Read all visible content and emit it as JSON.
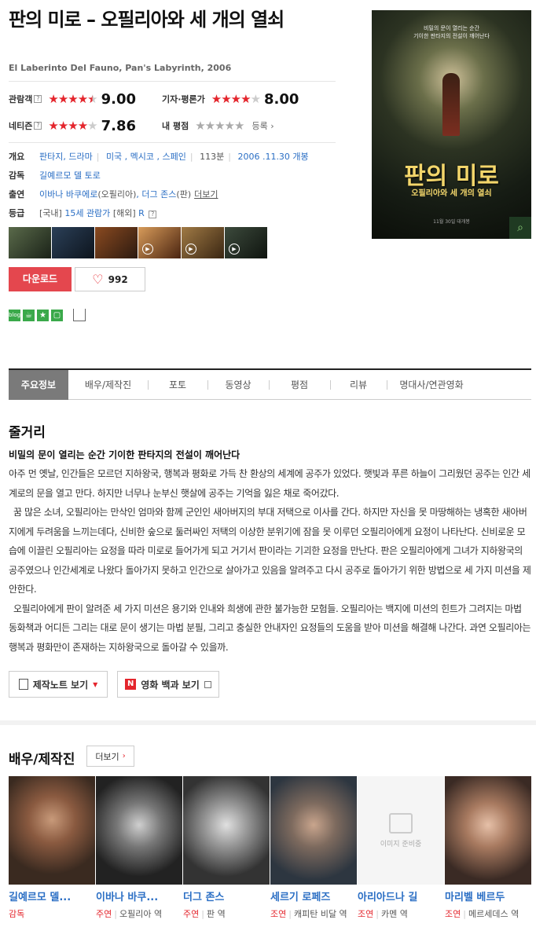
{
  "movie": {
    "title": "판의 미로 – 오필리아와 세 개의 열쇠",
    "original_title": "El Laberinto Del Fauno, Pan's Labyrinth, 2006"
  },
  "ratings": {
    "audience": {
      "label": "관람객",
      "stars": 4.5,
      "score": "9.00"
    },
    "critic": {
      "label": "기자·평론가",
      "stars": 4,
      "score": "8.00"
    },
    "netizen": {
      "label": "네티즌",
      "stars": 4,
      "score": "7.86"
    },
    "mine": {
      "label": "내 평점",
      "register": "등록"
    },
    "help_mark": "?",
    "star_glyphs": "★★★★★"
  },
  "info": {
    "genre_key": "개요",
    "genre": "판타지, 드라마",
    "country": "미국 , 멕시코 , 스페인",
    "runtime": "113분",
    "release": "2006 .11.30 개봉",
    "director_key": "감독",
    "director": "길예르모 델 토로",
    "cast_key": "출연",
    "cast1": "이바나 바쿠에로",
    "cast1_role": "(오필리아)",
    "cast2": "더그 존스",
    "cast2_role": "(판)",
    "cast_more": "더보기",
    "grade_key": "등급",
    "grade_domestic_tag": "[국내]",
    "grade_domestic": "15세 관람가",
    "grade_foreign_tag": "[해외]",
    "grade_foreign": "R"
  },
  "buttons": {
    "download": "다운로드",
    "likes": "992"
  },
  "share": {
    "blog": "blog"
  },
  "poster": {
    "tagline": "비밀의 문이 열리는 순간\n기이한 판타지의 전설이 깨어난다",
    "title": "판의 미로",
    "subtitle": "오필리아와 세 개의 열쇠",
    "date": "11월 30일 대개봉"
  },
  "tabs": [
    "주요정보",
    "배우/제작진",
    "포토",
    "동영상",
    "평점",
    "리뷰",
    "명대사/연관영화"
  ],
  "synopsis": {
    "heading": "줄거리",
    "lead": "비밀의 문이 열리는 순간 기이한 판타지의 전설이 깨어난다",
    "p1": "아주 먼 옛날, 인간들은 모르던 지하왕국, 행복과 평화로 가득 찬 환상의 세계에 공주가 있었다. 햇빛과 푸른 하늘이 그리웠던 공주는 인간 세계로의 문을 열고 만다. 하지만 너무나 눈부신 햇살에 공주는 기억을 잃은 채로 죽어갔다.",
    "p2": "꿈 많은 소녀, 오필리아는 만삭인 엄마와 함께 군인인 새아버지의 부대 저택으로 이사를 간다. 하지만 자신을 못 마땅해하는 냉혹한 새아버지에게 두려움을 느끼는데다, 신비한 숲으로 둘러싸인 저택의 이상한 분위기에 잠을 못 이루던 오필리아에게 요정이 나타난다. 신비로운 모습에 이끌린 오필리아는 요정을 따라 미로로 들어가게 되고 거기서 판이라는 기괴한 요정을 만난다. 판은 오필리아에게 그녀가 지하왕국의 공주였으나 인간세계로 나왔다 돌아가지 못하고 인간으로 살아가고 있음을 알려주고 다시 공주로 돌아가기 위한 방법으로 세 가지 미션을 제안한다.",
    "p3": "오필리아에게 판이 알려준 세 가지 미션은 용기와 인내와 희생에 관한 불가능한 모험들. 오필리아는 백지에 미션의 힌트가 그려지는 마법 동화책과 어디든 그리는 대로 문이 생기는 마법 분필, 그리고 충실한 안내자인 요정들의 도움을 받아 미션을 해결해 나간다. 과연 오필리아는 행복과 평화만이 존재하는 지하왕국으로 돌아갈 수 있을까."
  },
  "extras": {
    "production_note": "제작노트 보기",
    "wiki_badge": "N",
    "wiki": "영화 백과 보기"
  },
  "cast_section": {
    "heading": "배우/제작진",
    "more": "더보기",
    "no_image": "이미지 준비중",
    "people": [
      {
        "name": "길예르모 델...",
        "kind": "감독",
        "role": ""
      },
      {
        "name": "이바나 바쿠...",
        "kind": "주연",
        "role": "오필리아 역"
      },
      {
        "name": "더그 존스",
        "kind": "주연",
        "role": "판 역"
      },
      {
        "name": "세르기 로페즈",
        "kind": "조연",
        "role": "캐피탄 비달 역"
      },
      {
        "name": "아리아드나 길",
        "kind": "조연",
        "role": "카멘 역"
      },
      {
        "name": "마리벨 베르두",
        "kind": "조연",
        "role": "메르세데스 역"
      }
    ]
  },
  "colors": {
    "accent_red": "#e4252c",
    "link_blue": "#2a6ec4",
    "tab_active": "#7a7a7a"
  }
}
